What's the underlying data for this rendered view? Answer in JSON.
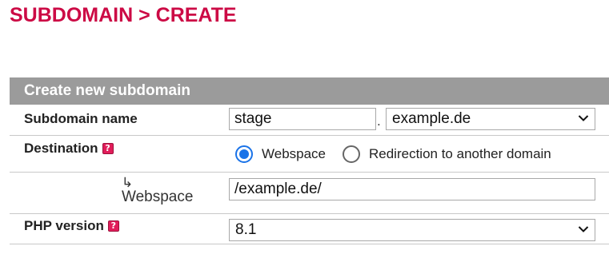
{
  "page_title": "SUBDOMAIN > CREATE",
  "panel": {
    "header": "Create new subdomain"
  },
  "subdomain_row": {
    "label": "Subdomain name",
    "input_value": "stage",
    "separator": ".",
    "domain_selected": "example.de"
  },
  "destination_row": {
    "label": "Destination",
    "options": [
      {
        "label": "Webspace",
        "checked": true
      },
      {
        "label": "Redirection to another domain",
        "checked": false
      }
    ]
  },
  "webspace_row": {
    "arrow": "↳",
    "label": "Webspace",
    "input_value": "/example.de/"
  },
  "php_row": {
    "label": "PHP version",
    "selected": "8.1"
  },
  "icons": {
    "help": "help-icon",
    "dropdown": "chevron-down-icon",
    "sub_arrow": "arrow-icon"
  },
  "colors": {
    "title": "#cc0a45",
    "header_bg": "#9b9b9b",
    "help_icon": "#e11d5a",
    "radio_accent": "#1a73e8"
  }
}
